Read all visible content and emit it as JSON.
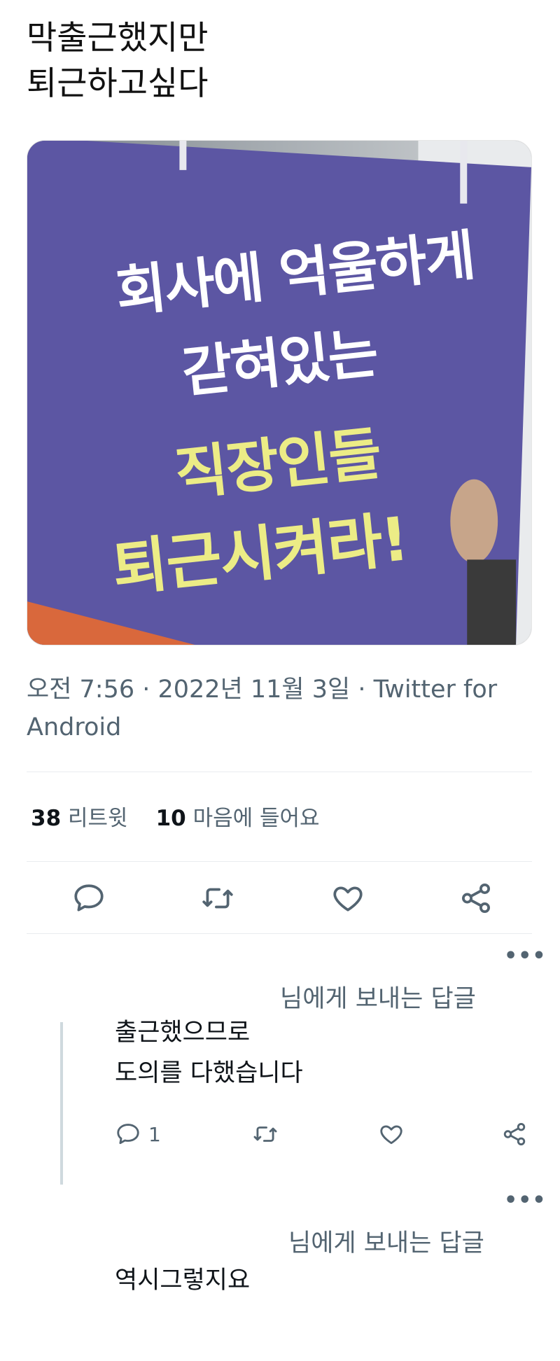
{
  "tweet": {
    "text": "막출근했지만\n퇴근하고싶다",
    "media": {
      "sign_lines": [
        "회사에 억울하게",
        "갇혀있는",
        "직장인들",
        "퇴근시켜라!"
      ]
    },
    "meta": "오전 7:56 · 2022년 11월 3일 · Twitter for Android",
    "stats": {
      "retweets_count": "38",
      "retweets_label": "리트윗",
      "likes_count": "10",
      "likes_label": "마음에 들어요"
    },
    "actions": [
      "reply-icon",
      "retweet-icon",
      "like-icon",
      "share-icon"
    ]
  },
  "replies": [
    {
      "replying_to": "님에게 보내는 답글",
      "text": "출근했으므로\n도의를 다했습니다",
      "reply_count": "1",
      "actions": [
        "reply-icon",
        "retweet-icon",
        "like-icon",
        "share-icon"
      ]
    },
    {
      "replying_to": "님에게 보내는 답글",
      "text": "역시그렇지요"
    }
  ],
  "colors": {
    "text": "#0f1419",
    "secondary": "#536471",
    "sign_bg": "#5c56a3",
    "sign_white": "#ffffff",
    "sign_yellow": "#ecec86",
    "divider": "#e9ecef"
  }
}
